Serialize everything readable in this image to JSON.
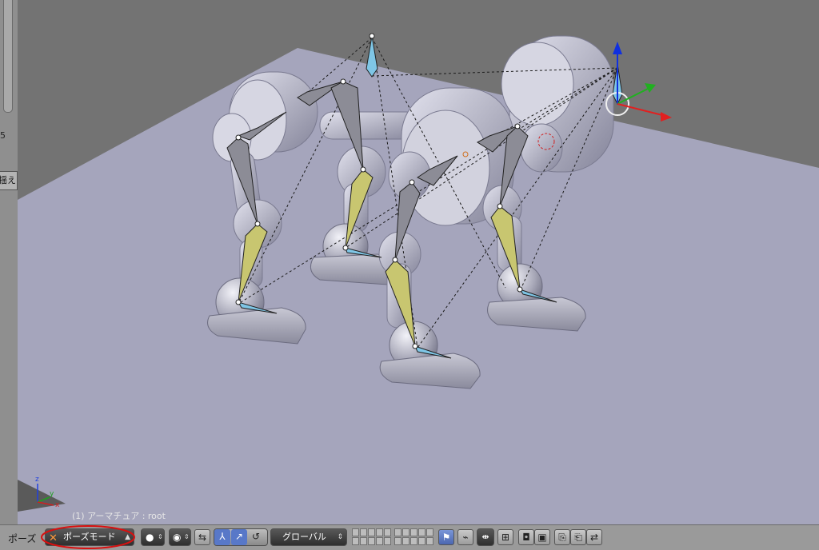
{
  "left_panel": {
    "partial_digit": "5",
    "partial_tab_label": "揺え"
  },
  "viewport": {
    "object_info": "(1) アーマチュア : root",
    "mini_axes": {
      "x": "x",
      "y": "y",
      "z": "z"
    },
    "colors": {
      "floor": "#a5a5bc",
      "background": "#737373",
      "bone_gray": "#8c8c96",
      "bone_yellow": "#c8c670",
      "bone_ik": "#7fc6e6",
      "manip_x": "#e02020",
      "manip_y": "#20b020",
      "manip_z": "#1030e0"
    }
  },
  "header": {
    "menu_label": "ポーズ",
    "mode_select": {
      "icon": "armature-icon",
      "value": "ポーズモード"
    },
    "shading_select": {
      "icon": "sphere-shading-icon"
    },
    "pivot_select": {
      "icon": "pivot-icon"
    },
    "orientation_select": {
      "value": "グローバル"
    },
    "colors": {
      "bar": "#9a9a9a",
      "annotation_circle": "#d81010"
    }
  }
}
